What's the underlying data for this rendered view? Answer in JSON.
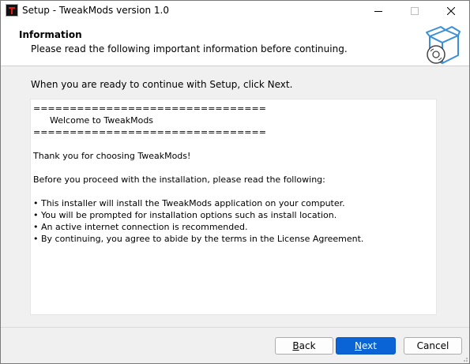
{
  "window": {
    "title": "Setup - TweakMods version 1.0",
    "icon": "app-logo-icon",
    "controls": [
      "minimize-icon",
      "maximize-icon",
      "close-icon"
    ]
  },
  "header": {
    "title": "Information",
    "subtitle": "Please read the following important information before continuing.",
    "image": "installer-box-icon"
  },
  "prompt": "When you are ready to continue with Setup, click Next.",
  "info": {
    "lines": [
      "================================",
      "      Welcome to TweakMods",
      "================================",
      "",
      "Thank you for choosing TweakMods!",
      "",
      "Before you proceed with the installation, please read the following:",
      "",
      "• This installer will install the TweakMods application on your computer.",
      "• You will be prompted for installation options such as install location.",
      "• An active internet connection is recommended.",
      "• By continuing, you agree to abide by the terms in the License Agreement."
    ]
  },
  "buttons": {
    "back_prefix": "",
    "back_underlined": "B",
    "back_rest": "ack",
    "next_prefix": "",
    "next_underlined": "N",
    "next_rest": "ext",
    "cancel": "Cancel"
  },
  "colors": {
    "accent": "#0a64d6",
    "logo_red": "#e21a1a",
    "icon_blue": "#3a8fd8"
  }
}
